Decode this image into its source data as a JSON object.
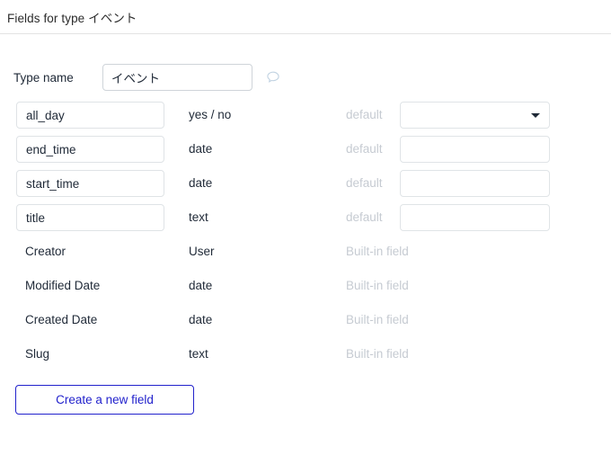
{
  "header": {
    "title": "Fields for type イベント"
  },
  "type_name": {
    "label": "Type name",
    "value": "イベント",
    "placeholder": "",
    "comment_icon": "speech-bubble-icon"
  },
  "columns": {
    "default_label": "default",
    "builtin_label": "Built-in field"
  },
  "fields": [
    {
      "name": "all_day",
      "type": "yes / no",
      "editable": true,
      "default_label": "default",
      "default_value": "",
      "control": "select",
      "caret_icon": "chevron-down-icon"
    },
    {
      "name": "end_time",
      "type": "date",
      "editable": true,
      "default_label": "default",
      "default_value": "",
      "control": "input"
    },
    {
      "name": "start_time",
      "type": "date",
      "editable": true,
      "default_label": "default",
      "default_value": "",
      "control": "input"
    },
    {
      "name": "title",
      "type": "text",
      "editable": true,
      "default_label": "default",
      "default_value": "",
      "control": "input"
    }
  ],
  "builtin_fields": [
    {
      "name": "Creator",
      "type": "User",
      "note": "Built-in field"
    },
    {
      "name": "Modified Date",
      "type": "date",
      "note": "Built-in field"
    },
    {
      "name": "Created Date",
      "type": "date",
      "note": "Built-in field"
    },
    {
      "name": "Slug",
      "type": "text",
      "note": "Built-in field"
    }
  ],
  "create_button": {
    "label": "Create a new field"
  },
  "colors": {
    "accent": "#2222cc",
    "muted_text": "#c6cbd2",
    "border": "#dfe3e6",
    "text": "#1f2937"
  }
}
